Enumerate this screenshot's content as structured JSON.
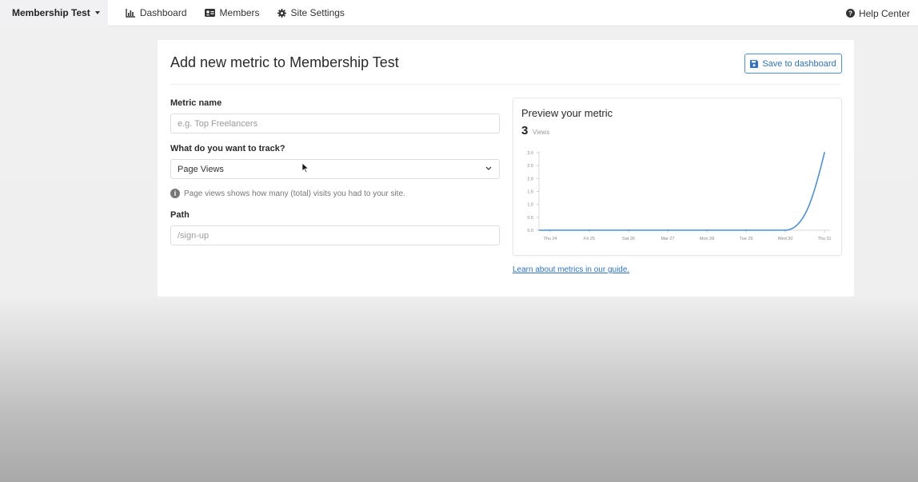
{
  "nav": {
    "site_name": "Membership Test",
    "dashboard": "Dashboard",
    "members": "Members",
    "site_settings": "Site Settings",
    "help_center": "Help Center"
  },
  "card": {
    "title": "Add new metric to Membership Test",
    "save_button": "Save to dashboard"
  },
  "form": {
    "metric_name_label": "Metric name",
    "metric_name_placeholder": "e.g. Top Freelancers",
    "metric_name_value": "",
    "track_label": "What do you want to track?",
    "track_selected": "Page Views",
    "track_hint": "Page views shows how many (total) visits you had to your site.",
    "path_label": "Path",
    "path_placeholder": "/sign-up",
    "path_value": ""
  },
  "preview": {
    "title": "Preview your metric",
    "value": "3",
    "unit": "Views"
  },
  "guide_link": "Learn about metrics in our guide.",
  "colors": {
    "accent": "#2f72c4",
    "line": "#4a90d9"
  },
  "chart_data": {
    "type": "line",
    "x": [
      "Thu 24",
      "Fri 25",
      "Sat 26",
      "Mar 27",
      "Mon 28",
      "Tue 29",
      "Wed 30",
      "Thu 31"
    ],
    "series": [
      {
        "values": [
          0,
          0,
          0,
          0,
          0,
          0,
          0,
          3
        ]
      }
    ],
    "yticks": [
      "0.0",
      "0.5",
      "1.0",
      "1.5",
      "2.0",
      "2.5",
      "3.0"
    ],
    "ylim": [
      0,
      3
    ],
    "title": "",
    "xlabel": "",
    "ylabel": "",
    "grid": false
  }
}
